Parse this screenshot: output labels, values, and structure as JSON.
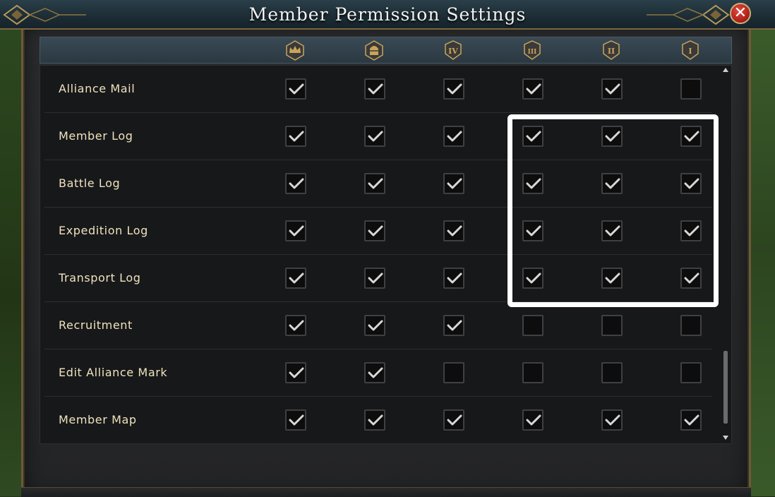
{
  "window": {
    "title": "Member Permission Settings",
    "close_symbol": "✕"
  },
  "columns": [
    {
      "rank": "R5",
      "icon": "crown-icon",
      "numeral": ""
    },
    {
      "rank": "R4",
      "icon": "helmet-icon",
      "numeral": ""
    },
    {
      "rank": "IV",
      "icon": "rank-shield-icon",
      "numeral": "IV"
    },
    {
      "rank": "III",
      "icon": "rank-shield-icon",
      "numeral": "III"
    },
    {
      "rank": "II",
      "icon": "rank-shield-icon",
      "numeral": "II"
    },
    {
      "rank": "I",
      "icon": "rank-shield-icon",
      "numeral": "I"
    }
  ],
  "rows": [
    {
      "label": "Alliance Mail",
      "checks": [
        true,
        true,
        true,
        true,
        true,
        false
      ]
    },
    {
      "label": "Member Log",
      "checks": [
        true,
        true,
        true,
        true,
        true,
        true
      ]
    },
    {
      "label": "Battle Log",
      "checks": [
        true,
        true,
        true,
        true,
        true,
        true
      ]
    },
    {
      "label": "Expedition Log",
      "checks": [
        true,
        true,
        true,
        true,
        true,
        true
      ]
    },
    {
      "label": "Transport Log",
      "checks": [
        true,
        true,
        true,
        true,
        true,
        true
      ]
    },
    {
      "label": "Recruitment",
      "checks": [
        true,
        true,
        true,
        false,
        false,
        false
      ]
    },
    {
      "label": "Edit Alliance Mark",
      "checks": [
        true,
        true,
        false,
        false,
        false,
        false
      ]
    },
    {
      "label": "Member Map",
      "checks": [
        true,
        true,
        true,
        true,
        true,
        true
      ]
    }
  ],
  "colors": {
    "label_text": "#efe2bd",
    "check_mark": "#d8d8d8",
    "highlight_border": "#ffffff",
    "accent_gold": "#c9a55a"
  }
}
